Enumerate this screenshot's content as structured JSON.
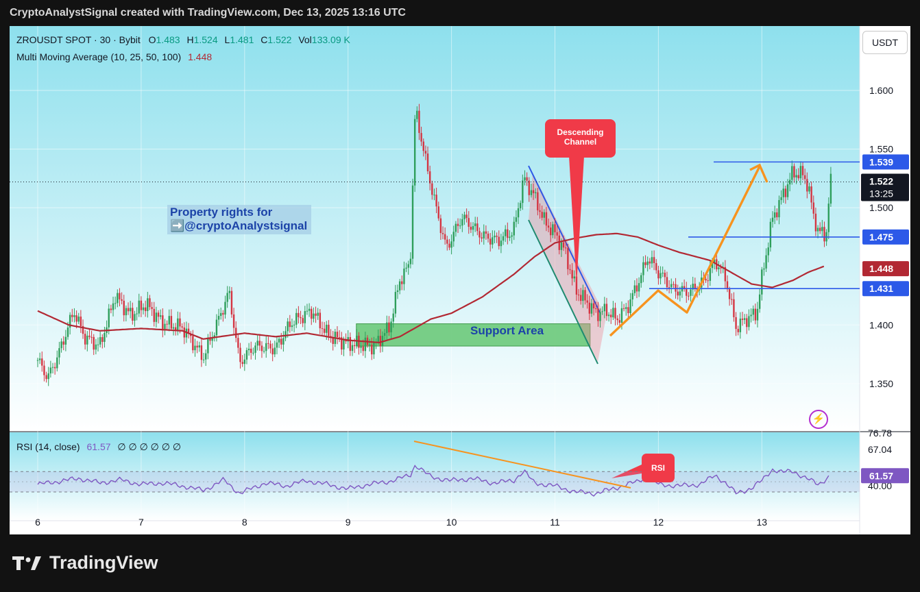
{
  "header": "CryptoAnalystSignal created with TradingView.com, Dec 13, 2025 13:16 UTC",
  "legend": {
    "symbol": "ZROUSDT SPOT · 30 · Bybit",
    "o_label": "O",
    "o": "1.483",
    "h_label": "H",
    "h": "1.524",
    "l_label": "L",
    "l": "1.481",
    "c_label": "C",
    "c": "1.522",
    "vol_label": "Vol",
    "vol": "133.09 K",
    "ma_label": "Multi Moving Average (10, 25, 50, 100)",
    "ma_value": "1.448",
    "rsi_label": "RSI (14, close)",
    "rsi_value": "61.57",
    "rsi_extras": "∅ ∅ ∅ ∅ ∅ ∅"
  },
  "currency_button": "USDT",
  "annotations": {
    "property_line1": "Property rights for",
    "property_line2": "➡️@cryptoAnalystsignal",
    "support": "Support Area",
    "descending": "Descending Channel",
    "rsi": "RSI"
  },
  "brand": "TradingView",
  "colors": {
    "background_top": "#8ee0ed",
    "up": "#2e9e5b",
    "down": "#d43441",
    "ma": "#b22833",
    "rsi": "#7e57c2",
    "arrow": "#f7931e",
    "level": "#2c59e8",
    "support": "#5cc36a"
  },
  "chart_data": {
    "type": "candlestick",
    "x_ticks": [
      "6",
      "7",
      "8",
      "9",
      "10",
      "11",
      "12",
      "13"
    ],
    "y_ticks": [
      "1.600",
      "1.550",
      "1.500",
      "1.400",
      "1.350"
    ],
    "ylim": [
      1.316,
      1.64
    ],
    "price_labels": [
      {
        "text": "1.539",
        "value": 1.539,
        "color": "#2c59e8"
      },
      {
        "text": "1.475",
        "value": 1.475,
        "color": "#2c59e8"
      },
      {
        "text": "1.448",
        "value": 1.448,
        "color": "#b22833"
      },
      {
        "text": "1.431",
        "value": 1.431,
        "color": "#2c59e8"
      }
    ],
    "current_price": {
      "text": "1.522",
      "countdown": "13:25",
      "value": 1.522
    },
    "horizontal_levels": [
      1.539,
      1.475,
      1.431
    ],
    "support_area": [
      1.382,
      1.401
    ],
    "price_keypoints": [
      [
        6.0,
        1.37
      ],
      [
        6.1,
        1.355
      ],
      [
        6.2,
        1.375
      ],
      [
        6.35,
        1.412
      ],
      [
        6.45,
        1.39
      ],
      [
        6.6,
        1.382
      ],
      [
        6.75,
        1.425
      ],
      [
        6.9,
        1.408
      ],
      [
        7.05,
        1.418
      ],
      [
        7.2,
        1.402
      ],
      [
        7.4,
        1.398
      ],
      [
        7.6,
        1.372
      ],
      [
        7.75,
        1.405
      ],
      [
        7.85,
        1.428
      ],
      [
        7.95,
        1.368
      ],
      [
        8.1,
        1.382
      ],
      [
        8.3,
        1.38
      ],
      [
        8.45,
        1.402
      ],
      [
        8.65,
        1.412
      ],
      [
        8.8,
        1.392
      ],
      [
        9.0,
        1.384
      ],
      [
        9.25,
        1.382
      ],
      [
        9.4,
        1.398
      ],
      [
        9.5,
        1.438
      ],
      [
        9.6,
        1.452
      ],
      [
        9.65,
        1.585
      ],
      [
        9.75,
        1.54
      ],
      [
        9.85,
        1.5
      ],
      [
        9.95,
        1.465
      ],
      [
        10.1,
        1.492
      ],
      [
        10.3,
        1.476
      ],
      [
        10.45,
        1.472
      ],
      [
        10.6,
        1.48
      ],
      [
        10.7,
        1.525
      ],
      [
        10.8,
        1.51
      ],
      [
        10.9,
        1.488
      ],
      [
        11.0,
        1.478
      ],
      [
        11.1,
        1.462
      ],
      [
        11.2,
        1.43
      ],
      [
        11.3,
        1.42
      ],
      [
        11.4,
        1.41
      ],
      [
        11.5,
        1.412
      ],
      [
        11.6,
        1.405
      ],
      [
        11.7,
        1.415
      ],
      [
        11.8,
        1.435
      ],
      [
        11.9,
        1.458
      ],
      [
        12.0,
        1.445
      ],
      [
        12.15,
        1.43
      ],
      [
        12.3,
        1.428
      ],
      [
        12.45,
        1.438
      ],
      [
        12.55,
        1.455
      ],
      [
        12.65,
        1.44
      ],
      [
        12.75,
        1.398
      ],
      [
        12.85,
        1.405
      ],
      [
        12.95,
        1.41
      ],
      [
        13.0,
        1.44
      ],
      [
        13.1,
        1.49
      ],
      [
        13.2,
        1.51
      ],
      [
        13.3,
        1.53
      ],
      [
        13.4,
        1.528
      ],
      [
        13.45,
        1.518
      ],
      [
        13.5,
        1.492
      ],
      [
        13.55,
        1.48
      ],
      [
        13.62,
        1.475
      ],
      [
        13.66,
        1.522
      ]
    ],
    "ma_keypoints": [
      [
        6.0,
        1.412
      ],
      [
        6.3,
        1.4
      ],
      [
        6.6,
        1.395
      ],
      [
        7.0,
        1.397
      ],
      [
        7.4,
        1.395
      ],
      [
        7.6,
        1.388
      ],
      [
        8.0,
        1.393
      ],
      [
        8.3,
        1.39
      ],
      [
        8.6,
        1.393
      ],
      [
        9.0,
        1.387
      ],
      [
        9.3,
        1.385
      ],
      [
        9.5,
        1.39
      ],
      [
        9.8,
        1.405
      ],
      [
        10.0,
        1.41
      ],
      [
        10.3,
        1.424
      ],
      [
        10.6,
        1.443
      ],
      [
        10.8,
        1.458
      ],
      [
        11.0,
        1.47
      ],
      [
        11.2,
        1.474
      ],
      [
        11.4,
        1.477
      ],
      [
        11.6,
        1.478
      ],
      [
        11.8,
        1.475
      ],
      [
        12.0,
        1.468
      ],
      [
        12.2,
        1.462
      ],
      [
        12.5,
        1.455
      ],
      [
        12.7,
        1.445
      ],
      [
        12.9,
        1.435
      ],
      [
        13.1,
        1.432
      ],
      [
        13.3,
        1.438
      ],
      [
        13.45,
        1.445
      ],
      [
        13.6,
        1.45
      ]
    ],
    "rsi_panel": {
      "y_ticks": [
        "76.78",
        "67.04",
        "40.00"
      ],
      "current": "61.57",
      "bands": [
        67.04,
        40.0
      ],
      "keypoints": [
        [
          6.0,
          50
        ],
        [
          6.2,
          54
        ],
        [
          6.4,
          58
        ],
        [
          6.6,
          52
        ],
        [
          6.8,
          56
        ],
        [
          7.0,
          50
        ],
        [
          7.2,
          52
        ],
        [
          7.4,
          48
        ],
        [
          7.6,
          42
        ],
        [
          7.8,
          56
        ],
        [
          7.95,
          38
        ],
        [
          8.2,
          52
        ],
        [
          8.4,
          48
        ],
        [
          8.6,
          55
        ],
        [
          8.8,
          50
        ],
        [
          9.0,
          44
        ],
        [
          9.2,
          50
        ],
        [
          9.4,
          54
        ],
        [
          9.6,
          62
        ],
        [
          9.65,
          76
        ],
        [
          9.8,
          60
        ],
        [
          10.0,
          55
        ],
        [
          10.2,
          58
        ],
        [
          10.4,
          52
        ],
        [
          10.6,
          55
        ],
        [
          10.7,
          68
        ],
        [
          10.8,
          52
        ],
        [
          11.0,
          48
        ],
        [
          11.2,
          40
        ],
        [
          11.4,
          38
        ],
        [
          11.6,
          46
        ],
        [
          11.8,
          54
        ],
        [
          11.9,
          62
        ],
        [
          12.0,
          50
        ],
        [
          12.2,
          48
        ],
        [
          12.4,
          50
        ],
        [
          12.55,
          62
        ],
        [
          12.65,
          52
        ],
        [
          12.75,
          38
        ],
        [
          12.9,
          45
        ],
        [
          13.0,
          55
        ],
        [
          13.1,
          70
        ],
        [
          13.2,
          66
        ],
        [
          13.3,
          68
        ],
        [
          13.4,
          60
        ],
        [
          13.55,
          50
        ],
        [
          13.66,
          61.57
        ]
      ]
    }
  }
}
